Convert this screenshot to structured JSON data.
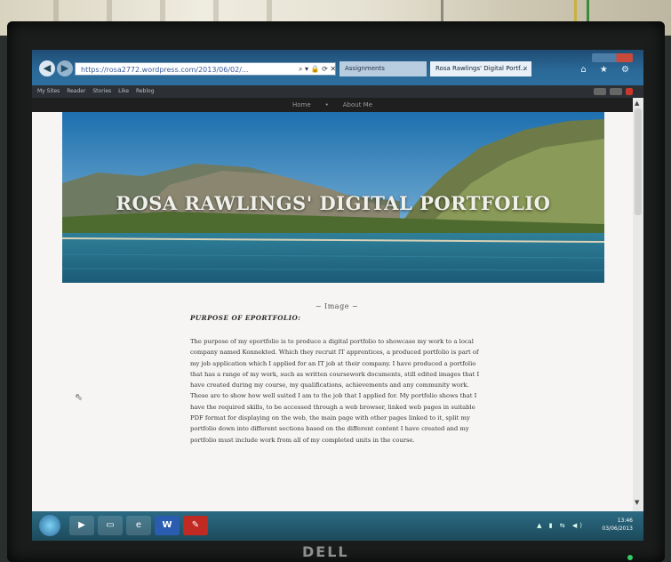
{
  "browser": {
    "address": "https://rosa2772.wordpress.com/2013/06/02/...",
    "address_icons": "⌕ ▾ 🔒 ⟳ ✕",
    "tabs": [
      {
        "label": "Assignments"
      },
      {
        "label": "Rosa Rawlings' Digital Portf..."
      }
    ],
    "tab_close": "×",
    "tools_glyphs": "⌂ ★ ⚙",
    "back_glyph": "◀",
    "forward_glyph": "▶"
  },
  "favorites": {
    "items": [
      "My Sites",
      "Reader",
      "Stories",
      "Like",
      "Reblog"
    ]
  },
  "site": {
    "nav": [
      "Home",
      "About Me"
    ],
    "nav_separator": "•",
    "title": "ROSA RAWLINGS' DIGITAL PORTFOLIO",
    "image_label": "~ Image ~",
    "section_heading": "Purpose Of Eportfolio:",
    "paragraph": "The purpose of my eportfolio is to produce a digital portfolio to showcase my work to a local company named Konnekted. Which they recruit IT apprentices, a produced portfolio is part of my job application which I applied for an IT job at their company. I have produced a portfolio that has a range of my work, such as written coursework documents, still edited images that I have created during my course, my qualifications, achievements and any community work. These are to show how well suited I am to the job that I applied for. My portfolio shows that I have the required skills, to be accessed through a web browser, linked web pages in suitable PDF format for displaying on the web, the main page with other pages linked to it, split my portfolio down into different sections based on the different content I have created and my portfolio must include work from all of my completed units in the course."
  },
  "taskbar": {
    "time": "13:46",
    "date": "03/06/2013",
    "tray_glyphs": "▲ ▮ ⇆ ◀)"
  },
  "monitor": {
    "brand": "DELL"
  },
  "colors": {
    "titlebar": "#2b6a98",
    "page_bg": "#f6f5f4",
    "nav_bar": "#1f1f1f",
    "taskbar": "#1d4a5c"
  }
}
